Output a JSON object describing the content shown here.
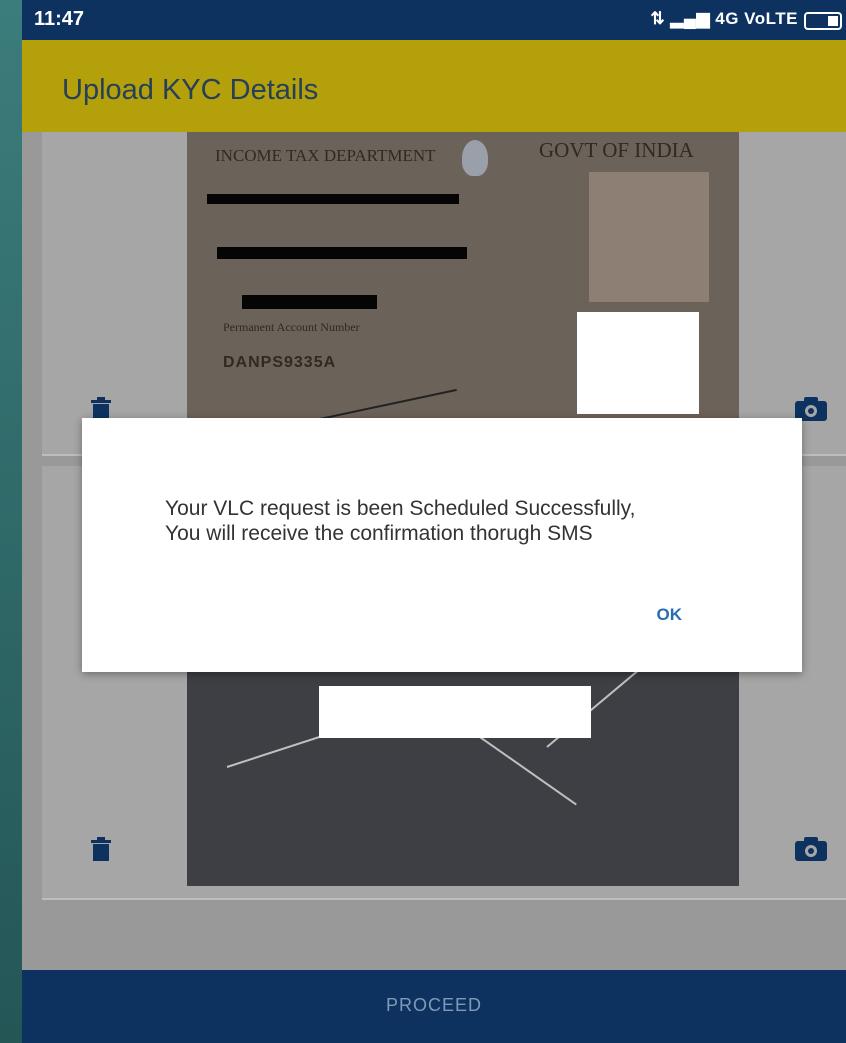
{
  "status_bar": {
    "time": "11:47",
    "network": "4G VoLTE"
  },
  "app_bar": {
    "title": "Upload KYC Details"
  },
  "documents": [
    {
      "header_left": "INCOME TAX DEPARTMENT",
      "header_right": "GOVT OF INDIA",
      "id_label": "Permanent Account Number",
      "id_number": "DANPS9335A"
    }
  ],
  "dialog": {
    "message": "Your VLC request is been Scheduled Successfully, You will receive the confirmation thorugh SMS",
    "ok_label": "OK"
  },
  "footer": {
    "proceed_label": "PROCEED"
  },
  "icons": {
    "delete": "trash-icon",
    "camera": "camera-icon"
  },
  "colors": {
    "primary_dark": "#0d3260",
    "app_bar": "#b3a00b",
    "ok_text": "#2a6bb3"
  }
}
